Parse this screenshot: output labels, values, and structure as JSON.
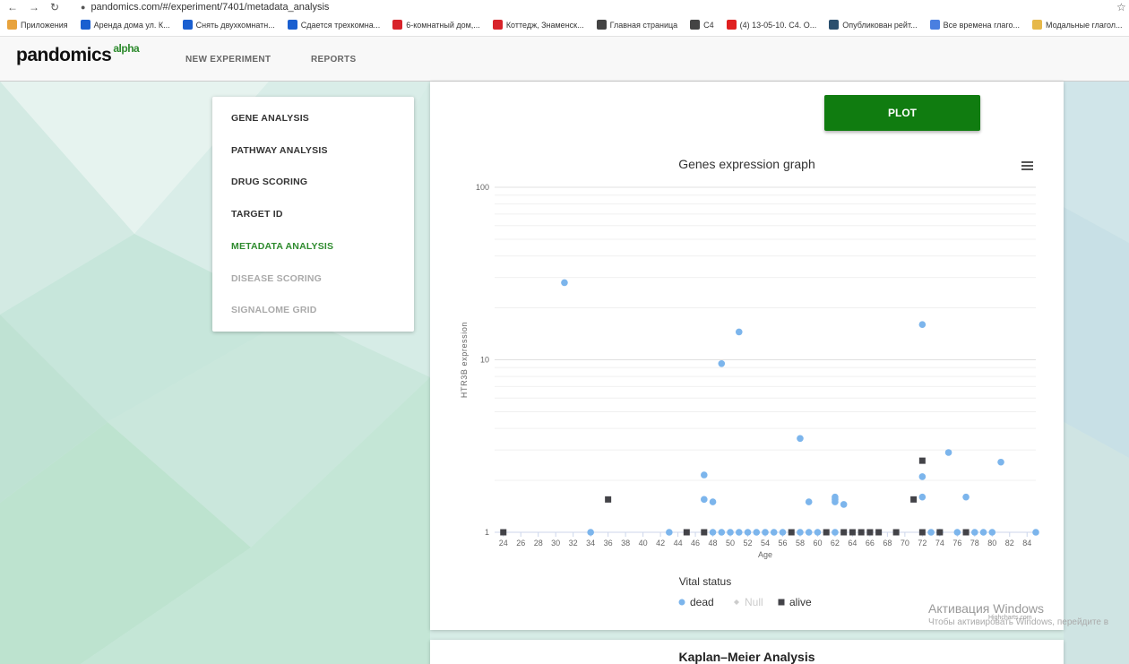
{
  "browser": {
    "url": "pandomics.com/#/experiment/7401/metadata_analysis",
    "bookmarks": [
      "Приложения",
      "Аренда дома ул. К...",
      "Снять двухкомнатн...",
      "Сдается трехкомна...",
      "6-комнатный дом,...",
      "Коттедж, Знаменск...",
      "Главная страница",
      "C4",
      "(4) 13-05-10. C4. O...",
      "Опубликован рейт...",
      "Все времена глаго...",
      "Модальные глагол..."
    ]
  },
  "app": {
    "logo": "pandomics",
    "logo_sup": "alpha",
    "nav": [
      "NEW EXPERIMENT",
      "REPORTS"
    ]
  },
  "menu": {
    "items": [
      {
        "label": "GENE ANALYSIS",
        "state": "normal"
      },
      {
        "label": "PATHWAY ANALYSIS",
        "state": "normal"
      },
      {
        "label": "DRUG SCORING",
        "state": "normal"
      },
      {
        "label": "TARGET ID",
        "state": "normal"
      },
      {
        "label": "METADATA ANALYSIS",
        "state": "active"
      },
      {
        "label": "DISEASE SCORING",
        "state": "disabled"
      },
      {
        "label": "SIGNALOME GRID",
        "state": "disabled"
      }
    ]
  },
  "plot_button": "PLOT",
  "chart_data": {
    "type": "scatter",
    "title": "Genes expression graph",
    "xlabel": "Age",
    "ylabel": "HTR3B expression",
    "yscale": "log",
    "ylim": [
      1,
      100
    ],
    "xlim": [
      23,
      85
    ],
    "x_ticks": [
      24,
      26,
      28,
      30,
      32,
      34,
      36,
      38,
      40,
      42,
      44,
      46,
      48,
      50,
      52,
      54,
      56,
      58,
      60,
      62,
      64,
      66,
      68,
      70,
      72,
      74,
      76,
      78,
      80,
      82,
      84
    ],
    "y_ticks": [
      1,
      10,
      100
    ],
    "y_tick_labels": [
      "1",
      "10",
      "100"
    ],
    "legend_title": "Vital status",
    "legend_position": "bottom",
    "grid": true,
    "series": [
      {
        "name": "dead",
        "color": "#7cb5ec",
        "marker": "circle",
        "points": [
          [
            31,
            28
          ],
          [
            34,
            1
          ],
          [
            43,
            1
          ],
          [
            47,
            1.55
          ],
          [
            47,
            2.15
          ],
          [
            48,
            1.5
          ],
          [
            48,
            1
          ],
          [
            49,
            9.5
          ],
          [
            49,
            1
          ],
          [
            50,
            1
          ],
          [
            51,
            14.5
          ],
          [
            51,
            1
          ],
          [
            52,
            1
          ],
          [
            53,
            1
          ],
          [
            54,
            1
          ],
          [
            55,
            1
          ],
          [
            56,
            1
          ],
          [
            58,
            3.5
          ],
          [
            58,
            1
          ],
          [
            59,
            1.5
          ],
          [
            59,
            1
          ],
          [
            60,
            1
          ],
          [
            62,
            1.6
          ],
          [
            62,
            1.55
          ],
          [
            62,
            1.5
          ],
          [
            62,
            1
          ],
          [
            63,
            1.45
          ],
          [
            72,
            16
          ],
          [
            72,
            2.1
          ],
          [
            72,
            1.6
          ],
          [
            73,
            1
          ],
          [
            74,
            1
          ],
          [
            75,
            2.9
          ],
          [
            76,
            1
          ],
          [
            77,
            1.6
          ],
          [
            78,
            1
          ],
          [
            79,
            1
          ],
          [
            80,
            1
          ],
          [
            81,
            2.55
          ],
          [
            85,
            1
          ]
        ]
      },
      {
        "name": "Null",
        "color": "#cccccc",
        "marker": "diamond",
        "points": []
      },
      {
        "name": "alive",
        "color": "#434348",
        "marker": "square",
        "points": [
          [
            24,
            1
          ],
          [
            36,
            1.55
          ],
          [
            45,
            1
          ],
          [
            47,
            1
          ],
          [
            57,
            1
          ],
          [
            61,
            1
          ],
          [
            63,
            1
          ],
          [
            64,
            1
          ],
          [
            65,
            1
          ],
          [
            66,
            1
          ],
          [
            67,
            1
          ],
          [
            69,
            1
          ],
          [
            71,
            1.55
          ],
          [
            72,
            2.6
          ],
          [
            72,
            1
          ],
          [
            74,
            1
          ],
          [
            77,
            1
          ]
        ]
      }
    ]
  },
  "chart_credits": "Highcharts.com",
  "kaplan_meier_title": "Kaplan–Meier Analysis",
  "watermark": {
    "line1": "Активация Windows",
    "line2": "Чтобы активировать Windows, перейдите в"
  }
}
